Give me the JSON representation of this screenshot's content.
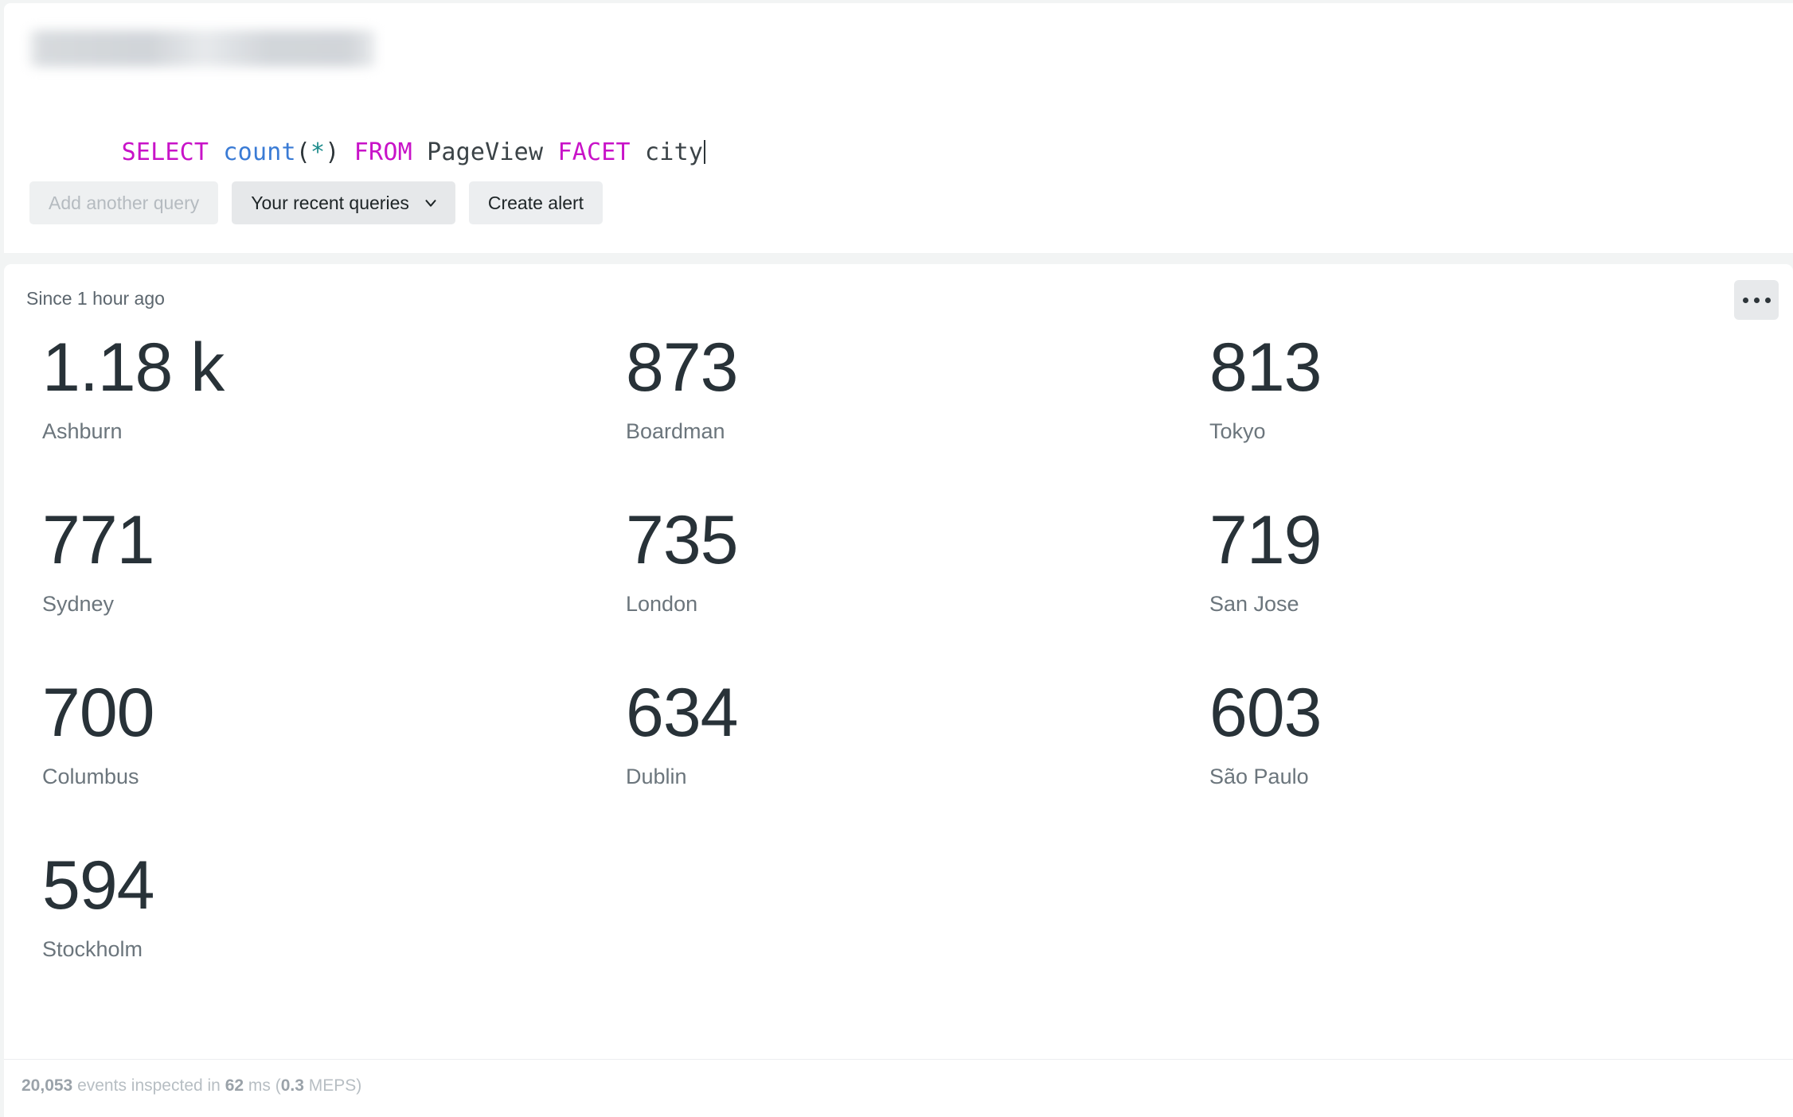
{
  "page": {
    "background_color": "#f2f4f4",
    "panel_color": "#ffffff"
  },
  "query_panel": {
    "redacted_field": {
      "name": "redacted-account-selector",
      "visible_text": ""
    },
    "query": {
      "tokens": [
        {
          "text": "SELECT",
          "type": "keyword",
          "color": "#c813c8"
        },
        {
          "text": " ",
          "type": "space"
        },
        {
          "text": "count",
          "type": "function",
          "color": "#3a7bd5"
        },
        {
          "text": "(",
          "type": "punct",
          "color": "#2d3539"
        },
        {
          "text": "*",
          "type": "star",
          "color": "#1a8a8a"
        },
        {
          "text": ")",
          "type": "punct",
          "color": "#2d3539"
        },
        {
          "text": " ",
          "type": "space"
        },
        {
          "text": "FROM",
          "type": "keyword",
          "color": "#c813c8"
        },
        {
          "text": " ",
          "type": "space"
        },
        {
          "text": "PageView",
          "type": "identifier",
          "color": "#3b4347"
        },
        {
          "text": " ",
          "type": "space"
        },
        {
          "text": "FACET",
          "type": "keyword",
          "color": "#c813c8"
        },
        {
          "text": " ",
          "type": "space"
        },
        {
          "text": "city",
          "type": "identifier",
          "color": "#3b4347"
        }
      ],
      "full_text": "SELECT count(*) FROM PageView FACET city",
      "segments": {
        "select": "SELECT",
        "count": "count",
        "open_paren": "(",
        "star": "*",
        "close_paren": ")",
        "from": "FROM",
        "pageview": "PageView",
        "facet": "FACET",
        "city": "city"
      }
    },
    "buttons": {
      "add_another_query": "Add another query",
      "your_recent_queries": "Your recent queries",
      "create_alert": "Create alert"
    }
  },
  "results_panel": {
    "since_label": "Since 1 hour ago",
    "more_menu_icon": "ellipsis-icon",
    "facets": [
      {
        "value": "1.18 k",
        "label": "Ashburn"
      },
      {
        "value": "873",
        "label": "Boardman"
      },
      {
        "value": "813",
        "label": "Tokyo"
      },
      {
        "value": "771",
        "label": "Sydney"
      },
      {
        "value": "735",
        "label": "London"
      },
      {
        "value": "719",
        "label": "San Jose"
      },
      {
        "value": "700",
        "label": "Columbus"
      },
      {
        "value": "634",
        "label": "Dublin"
      },
      {
        "value": "603",
        "label": "São Paulo"
      },
      {
        "value": "594",
        "label": "Stockholm"
      }
    ],
    "footer": {
      "events_count": "20,053",
      "events_text": " events inspected in ",
      "duration": "62",
      "duration_unit": " ms (",
      "meps_value": "0.3",
      "meps_unit": " MEPS)"
    }
  }
}
